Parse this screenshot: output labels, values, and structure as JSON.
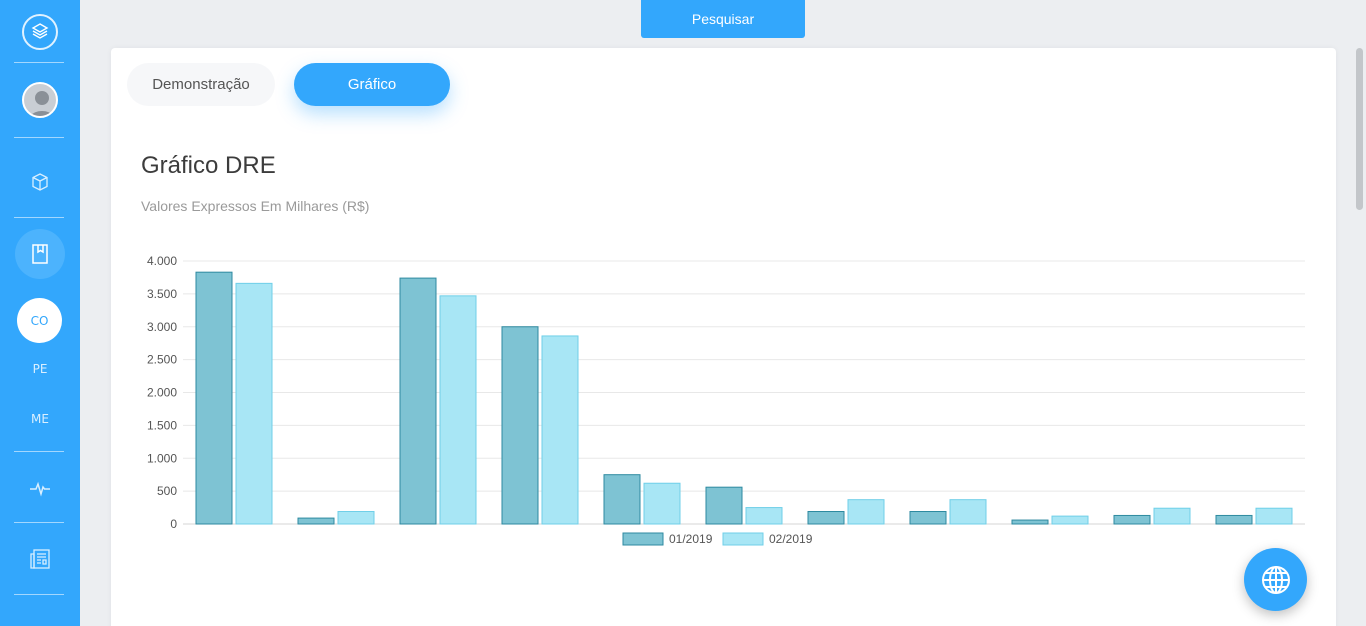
{
  "search": {
    "label": "Pesquisar"
  },
  "sidebar": {
    "items": [
      {
        "icon": "logo-icon"
      },
      {
        "icon": "avatar"
      },
      {
        "icon": "box-icon"
      },
      {
        "icon": "book-icon"
      },
      {
        "label": "CO"
      },
      {
        "label": "PE"
      },
      {
        "label": "ME"
      },
      {
        "icon": "pulse-icon"
      },
      {
        "icon": "report-icon"
      }
    ]
  },
  "tabs": [
    {
      "label": "Demonstração",
      "active": false
    },
    {
      "label": "Gráfico",
      "active": true
    }
  ],
  "header": {
    "title": "Gráfico DRE",
    "subtitle": "Valores Expressos Em Milhares (R$)"
  },
  "colors": {
    "accent": "#33a7fc",
    "series1": "#7ec3d3",
    "series1_border": "#2e8aa0",
    "series2": "#a8e6f5",
    "series2_border": "#6fcfe8"
  },
  "chart_data": {
    "type": "bar",
    "categories": [
      "",
      "",
      "",
      "",
      "",
      "",
      "",
      "",
      "",
      "",
      ""
    ],
    "series": [
      {
        "name": "01/2019",
        "values": [
          3830,
          90,
          3740,
          3000,
          750,
          560,
          190,
          190,
          60,
          130,
          130
        ]
      },
      {
        "name": "02/2019",
        "values": [
          3660,
          190,
          3470,
          2860,
          620,
          250,
          370,
          370,
          120,
          240,
          240
        ]
      }
    ],
    "yticks": [
      "0",
      "500",
      "1.000",
      "1.500",
      "2.000",
      "2.500",
      "3.000",
      "3.500",
      "4.000"
    ],
    "ylim": [
      0,
      4000
    ],
    "grid": true,
    "legend": "bottom"
  },
  "fab": {
    "icon": "globe-icon"
  }
}
